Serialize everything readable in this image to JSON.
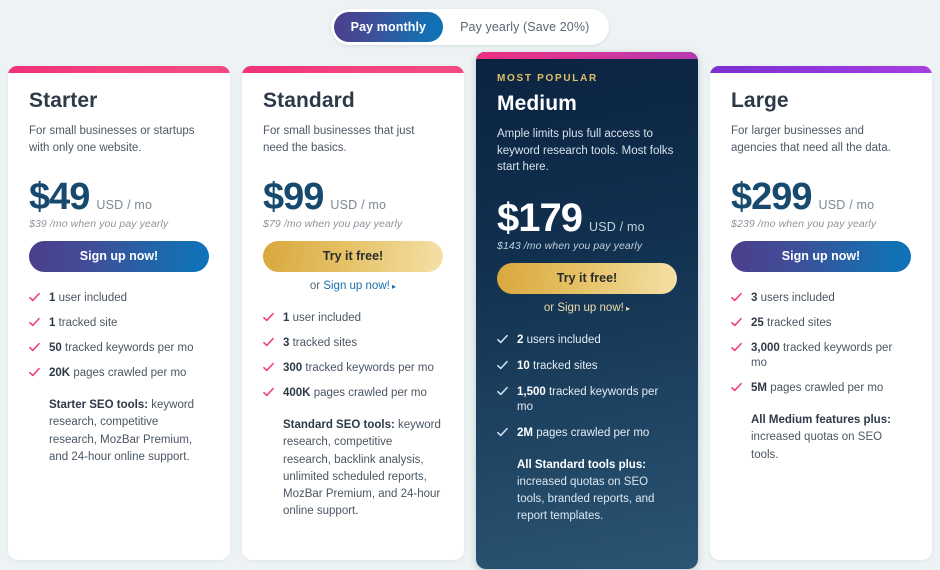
{
  "billing_toggle": {
    "monthly_label": "Pay monthly",
    "yearly_label": "Pay yearly (Save 20%)",
    "active": "monthly"
  },
  "colors": {
    "page_bg": "#edf3f4",
    "accent_pink": "#f2337f",
    "accent_purple": "#9036db",
    "popular_bg": "#11304f",
    "gold": "#e0c068",
    "price_blue": "#174a6e",
    "link_blue": "#1b6fae"
  },
  "plans": [
    {
      "name": "Starter",
      "description": "For small businesses or startups with only one website.",
      "price": "$49",
      "price_unit": "USD / mo",
      "yearly_note": "$39 /mo when you pay yearly",
      "primary_cta": "Sign up now!",
      "primary_cta_style": "signup",
      "secondary_prefix": "",
      "secondary_cta": "",
      "accent": "pink",
      "popular": false,
      "badge": "",
      "features": [
        {
          "value": "1",
          "text": "user included"
        },
        {
          "value": "1",
          "text": "tracked site"
        },
        {
          "value": "50",
          "text": "tracked keywords per mo"
        },
        {
          "value": "20K",
          "text": "pages crawled per mo"
        }
      ],
      "footnote_strong": "Starter SEO tools:",
      "footnote_text": " keyword research, competitive research, MozBar Premium, and 24-hour online support."
    },
    {
      "name": "Standard",
      "description": "For small businesses that just need the basics.",
      "price": "$99",
      "price_unit": "USD / mo",
      "yearly_note": "$79 /mo when you pay yearly",
      "primary_cta": "Try it free!",
      "primary_cta_style": "try",
      "secondary_prefix": "or ",
      "secondary_cta": "Sign up now!",
      "accent": "pink",
      "popular": false,
      "badge": "",
      "features": [
        {
          "value": "1",
          "text": "user included"
        },
        {
          "value": "3",
          "text": "tracked sites"
        },
        {
          "value": "300",
          "text": "tracked keywords per mo"
        },
        {
          "value": "400K",
          "text": "pages crawled per mo"
        }
      ],
      "footnote_strong": "Standard SEO tools:",
      "footnote_text": " keyword research, competitive research, backlink analysis, unlimited scheduled reports, MozBar Premium, and 24-hour online support."
    },
    {
      "name": "Medium",
      "description": "Ample limits plus full access to keyword research tools. Most folks start here.",
      "price": "$179",
      "price_unit": "USD / mo",
      "yearly_note": "$143 /mo when you pay yearly",
      "primary_cta": "Try it free!",
      "primary_cta_style": "try",
      "secondary_prefix": "or ",
      "secondary_cta": "Sign up now!",
      "accent": "popular",
      "popular": true,
      "badge": "MOST POPULAR",
      "features": [
        {
          "value": "2",
          "text": "users included"
        },
        {
          "value": "10",
          "text": "tracked sites"
        },
        {
          "value": "1,500",
          "text": "tracked keywords per mo"
        },
        {
          "value": "2M",
          "text": "pages crawled per mo"
        }
      ],
      "footnote_strong": "All Standard tools plus:",
      "footnote_text": " increased quotas on SEO tools, branded reports, and report templates."
    },
    {
      "name": "Large",
      "description": "For larger businesses and agencies that need all the data.",
      "price": "$299",
      "price_unit": "USD / mo",
      "yearly_note": "$239 /mo when you pay yearly",
      "primary_cta": "Sign up now!",
      "primary_cta_style": "signup",
      "secondary_prefix": "",
      "secondary_cta": "",
      "accent": "purple",
      "popular": false,
      "badge": "",
      "features": [
        {
          "value": "3",
          "text": "users included"
        },
        {
          "value": "25",
          "text": "tracked sites"
        },
        {
          "value": "3,000",
          "text": "tracked keywords per mo"
        },
        {
          "value": "5M",
          "text": "pages crawled per mo"
        }
      ],
      "footnote_strong": "All Medium features plus:",
      "footnote_text": " increased quotas on SEO tools."
    }
  ]
}
